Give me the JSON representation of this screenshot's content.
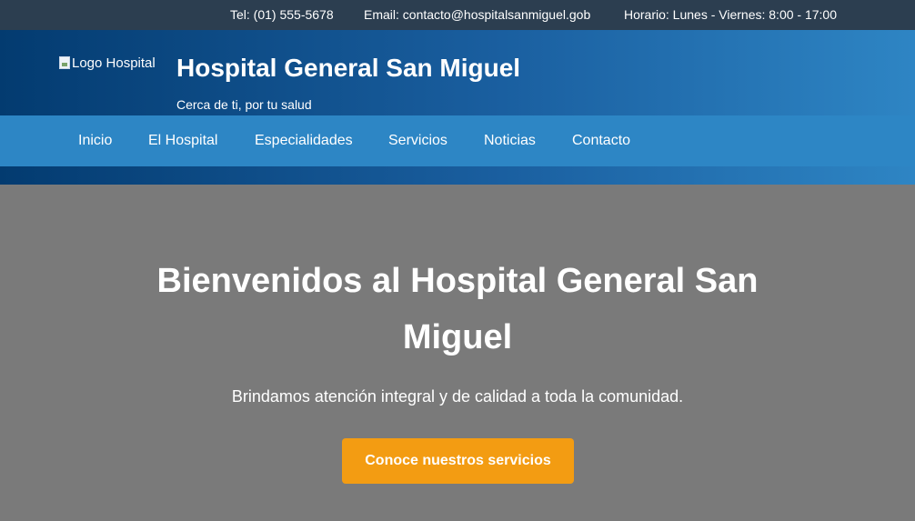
{
  "topbar": {
    "phone": "Tel: (01) 555-5678",
    "email": "Email: contacto@hospitalsanmiguel.gob",
    "hours": "Horario: Lunes - Viernes: 8:00 - 17:00"
  },
  "header": {
    "logo_alt": "Logo Hospital",
    "title": "Hospital General San Miguel",
    "tagline": "Cerca de ti, por tu salud"
  },
  "nav": {
    "items": [
      {
        "label": "Inicio"
      },
      {
        "label": "El Hospital"
      },
      {
        "label": "Especialidades"
      },
      {
        "label": "Servicios"
      },
      {
        "label": "Noticias"
      },
      {
        "label": "Contacto"
      }
    ]
  },
  "hero": {
    "title": "Bienvenidos al Hospital General San Miguel",
    "subtitle": "Brindamos atención integral y de calidad a toda la comunidad.",
    "button_label": "Conoce nuestros servicios"
  },
  "colors": {
    "topbar_bg": "#2c3e50",
    "header_gradient_start": "#033b70",
    "header_gradient_end": "#2e85c4",
    "nav_bg": "#2d86c5",
    "hero_bg": "#7a7a7a",
    "cta_button": "#f39c12"
  }
}
